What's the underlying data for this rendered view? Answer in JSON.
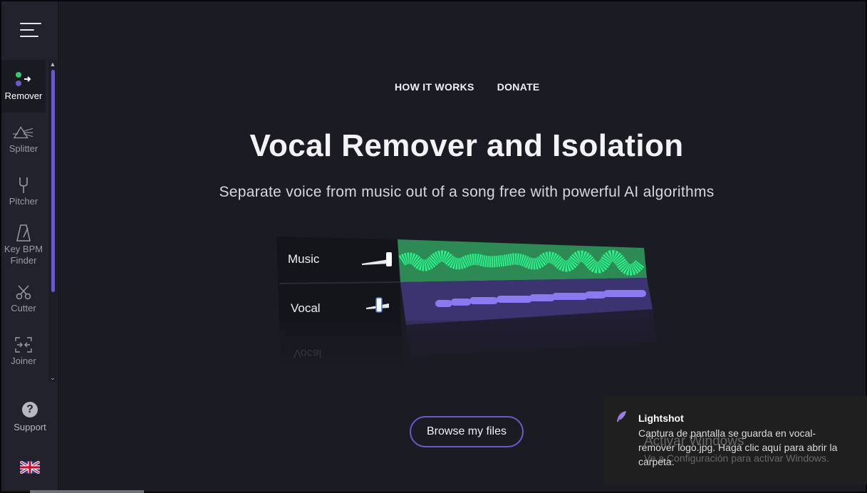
{
  "sidebar": {
    "items": [
      {
        "label": "Remover",
        "icon": "remover-icon"
      },
      {
        "label": "Splitter",
        "icon": "prism-icon"
      },
      {
        "label": "Pitcher",
        "icon": "tuning-fork-icon"
      },
      {
        "label": "Key BPM Finder",
        "icon": "metronome-icon"
      },
      {
        "label": "Cutter",
        "icon": "scissors-icon"
      },
      {
        "label": "Joiner",
        "icon": "join-icon"
      }
    ],
    "support_label": "Support",
    "support_icon": "question-icon",
    "language_icon": "uk-flag-icon"
  },
  "topnav": {
    "how_it_works": "HOW IT WORKS",
    "donate": "DONATE"
  },
  "hero": {
    "title": "Vocal Remover and Isolation",
    "subtitle": "Separate voice from music out of a song free with powerful AI algorithms"
  },
  "illustration": {
    "tracks": [
      {
        "label": "Music",
        "color": "#29e07a"
      },
      {
        "label": "Vocal",
        "color": "#7a6ae0"
      }
    ],
    "reflection_label": "Vocal"
  },
  "browse_button": "Browse my files",
  "toast": {
    "app": "Lightshot",
    "message": "Captura de pantalla se guarda en vocal-remover logo.jpg. Haga clic aquí para abrir la carpeta.",
    "watermark_title": "Activar Windows",
    "watermark_sub": "Ve a Configuración para activar Windows."
  },
  "colors": {
    "accent": "#6a59c9",
    "music": "#29e07a",
    "vocal": "#7a6ae0"
  }
}
